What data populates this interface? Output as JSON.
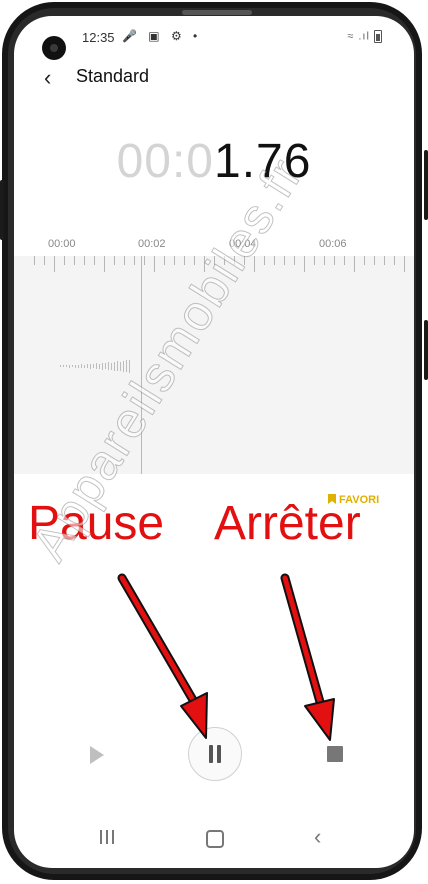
{
  "statusbar": {
    "time": "12:35",
    "left_icons": [
      "microphone-icon",
      "image-icon",
      "gear-icon",
      "dot-icon"
    ],
    "left_glyphs": "🎤 ▣ ⚙ •",
    "right_glyphs": "≈ .ıl"
  },
  "header": {
    "back_glyph": "‹",
    "title": "Standard"
  },
  "timer": {
    "dim_part": "00:0",
    "bright_part": "1.76"
  },
  "timeline": {
    "labels": [
      "00:00",
      "00:02",
      "00:04",
      "00:06"
    ]
  },
  "favorite": {
    "label": "FAVORI",
    "color": "#e0b000"
  },
  "annotations": {
    "pause_label": "Pause",
    "stop_label": "Arrêter",
    "color": "#e21010"
  },
  "watermark": {
    "text": "Appareilsmobiles.fr"
  },
  "navbar": {
    "back_glyph": "‹"
  }
}
